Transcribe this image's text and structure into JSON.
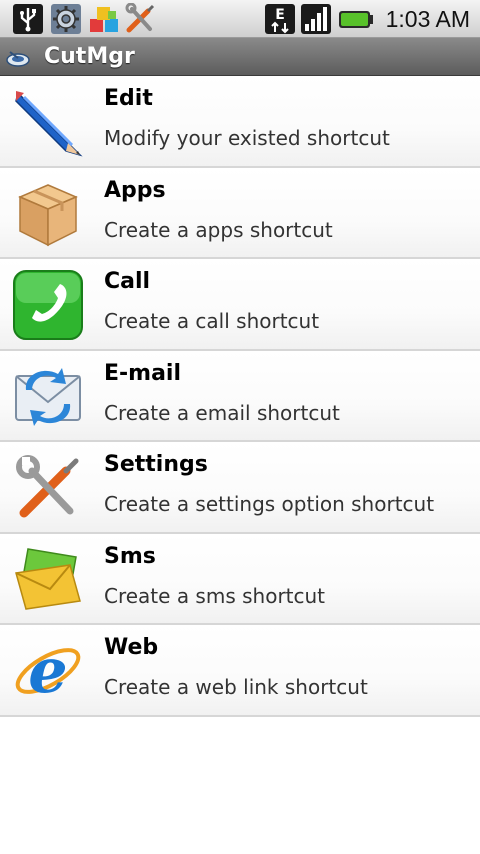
{
  "status_bar": {
    "icons": [
      "usb-icon",
      "settings-gear-icon",
      "apps-blocks-icon",
      "tools-icon",
      "edge-signal-icon",
      "signal-bars-icon",
      "battery-icon"
    ],
    "network_label": "E",
    "time": "1:03 AM"
  },
  "app": {
    "title": "CutMgr",
    "icon": "cutmgr-app-icon"
  },
  "menu": {
    "items": [
      {
        "title": "Edit",
        "description": "Modify your existed shortcut",
        "icon": "pencil-icon"
      },
      {
        "title": "Apps",
        "description": "Create a apps shortcut",
        "icon": "package-box-icon"
      },
      {
        "title": "Call",
        "description": "Create a call shortcut",
        "icon": "phone-icon"
      },
      {
        "title": "E-mail",
        "description": "Create a email shortcut",
        "icon": "email-sync-icon"
      },
      {
        "title": "Settings",
        "description": "Create a settings option shortcut",
        "icon": "wrench-screwdriver-icon"
      },
      {
        "title": "Sms",
        "description": "Create a sms shortcut",
        "icon": "envelope-icon"
      },
      {
        "title": "Web",
        "description": "Create a web link shortcut",
        "icon": "browser-e-icon"
      }
    ]
  }
}
